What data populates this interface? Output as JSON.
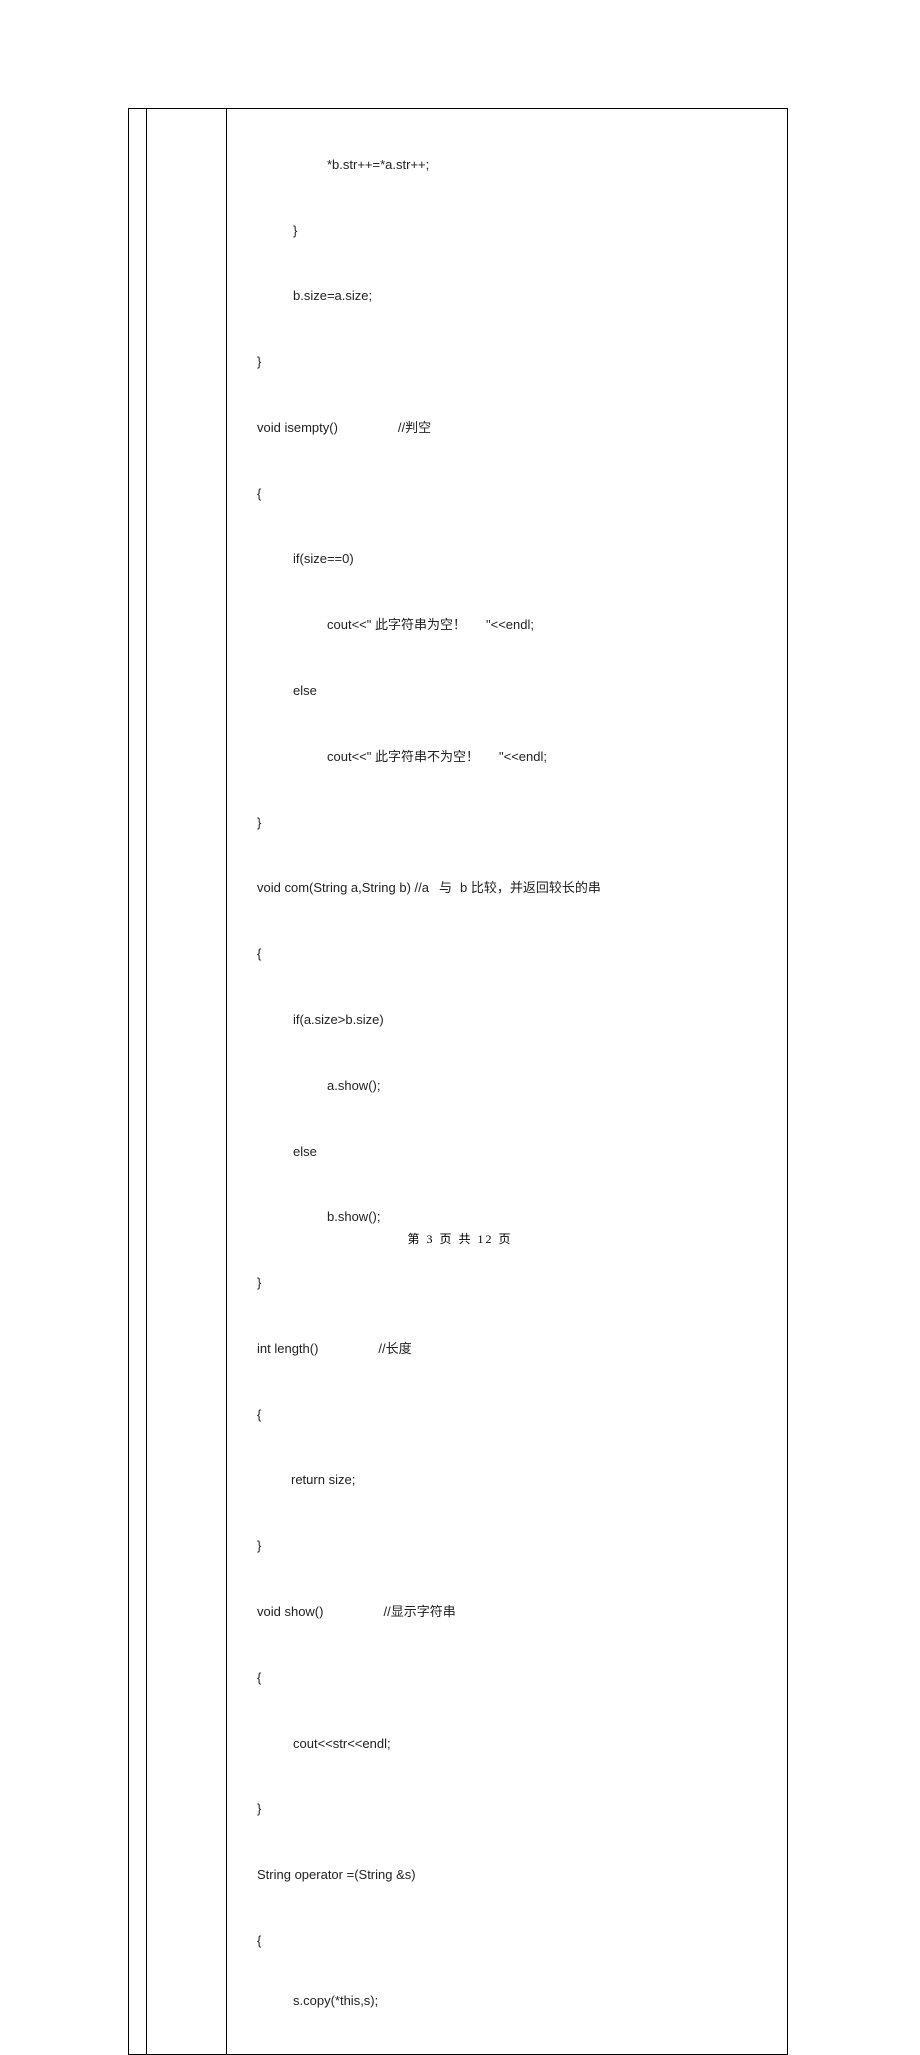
{
  "code": {
    "l01": "*b.str++=*a.str++;",
    "l02": "}",
    "l03": "b.size=a.size;",
    "l04": "}",
    "l05a": "void isempty()",
    "l05b": "//判空",
    "l06": "{",
    "l07": "if(size==0)",
    "l08a": "cout<<\" 此字符串为空！",
    "l08b": "\"<<endl;",
    "l09": "else",
    "l10a": "cout<<\" 此字符串不为空！",
    "l10b": "\"<<endl;",
    "l11": "}",
    "l12a": "void com(String a,String b) //a",
    "l12b": "与",
    "l12c": "b 比较，并返回较长的串",
    "l13": "{",
    "l14": "if(a.size>b.size)",
    "l15": "a.show();",
    "l16": "else",
    "l17": "b.show();",
    "l18": "}",
    "l19a": "int length()",
    "l19b": "//长度",
    "l20": "{",
    "l21": "return size;",
    "l22": "}",
    "l23a": "void show()",
    "l23b": "//显示字符串",
    "l24": "{",
    "l25": "cout<<str<<endl;",
    "l26": "}",
    "l27": "String operator =(String &s)",
    "l28": "{",
    "l29": "s.copy(*this,s);"
  },
  "footer": "第 3 页 共 12 页"
}
